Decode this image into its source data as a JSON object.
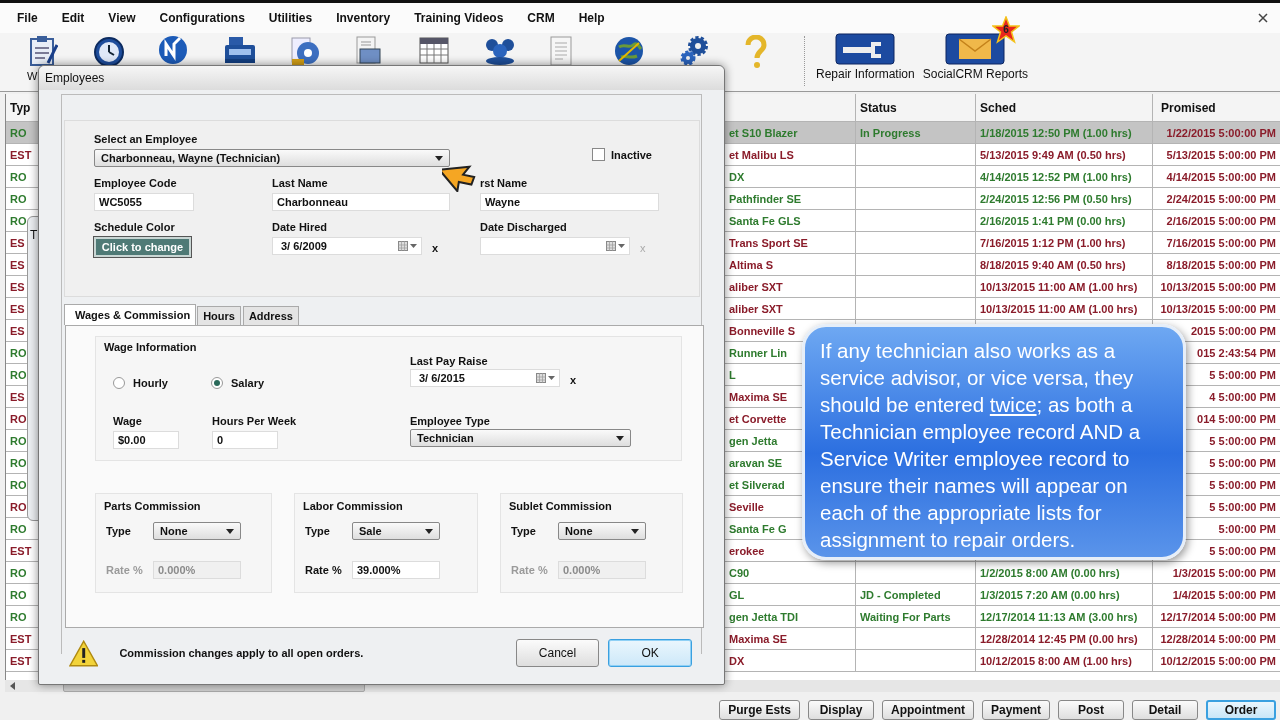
{
  "menu": [
    "File",
    "Edit",
    "View",
    "Configurations",
    "Utilities",
    "Inventory",
    "Training Videos",
    "CRM",
    "Help"
  ],
  "toolbar": {
    "buttons": [
      {
        "kind": "clipboard",
        "label": "W"
      },
      {
        "kind": "clock"
      },
      {
        "kind": "check-circle"
      },
      {
        "kind": "register"
      },
      {
        "kind": "disc"
      },
      {
        "kind": "files"
      },
      {
        "kind": "calendar"
      },
      {
        "kind": "people"
      },
      {
        "kind": "document"
      },
      {
        "kind": "globe"
      },
      {
        "kind": "gears"
      },
      {
        "kind": "help"
      }
    ],
    "large_buttons": [
      {
        "kind": "wrench",
        "label": "Repair Information"
      },
      {
        "kind": "envelope",
        "label": "SocialCRM Reports",
        "badge": "6"
      }
    ]
  },
  "table": {
    "columns": [
      "Typ",
      "Status",
      "Sched",
      "Promised"
    ],
    "rows": [
      {
        "type": "RO",
        "vehicle": "et S10 Blazer",
        "status": "In Progress",
        "sched": "1/18/2015 12:50 PM (1.00 hrs)",
        "promised": "1/22/2015 5:00:00 PM",
        "color": "#2e7b2e",
        "selected": true
      },
      {
        "type": "EST",
        "vehicle": "et Malibu LS",
        "sched": "5/13/2015 9:49 AM (0.50 hrs)",
        "promised": "5/13/2015 5:00:00 PM",
        "color": "#8a1c2a",
        "selected": false
      },
      {
        "type": "RO",
        "vehicle": "DX",
        "sched": "4/14/2015 12:52 PM (1.00 hrs)",
        "promised": "4/14/2015 5:00:00 PM",
        "color": "#2e7b2e",
        "selected": false
      },
      {
        "type": "RO",
        "vehicle": "Pathfinder SE",
        "sched": "2/24/2015 12:56 PM (0.50 hrs)",
        "promised": "2/24/2015 5:00:00 PM",
        "color": "#2e7b2e",
        "selected": false
      },
      {
        "type": "RO",
        "vehicle": "Santa Fe GLS",
        "sched": "2/16/2015 1:41 PM (0.00 hrs)",
        "promised": "2/16/2015 5:00:00 PM",
        "color": "#2e7b2e",
        "selected": false
      },
      {
        "type": "ES",
        "vehicle": "Trans Sport SE",
        "sched": "7/16/2015 1:12 PM (1.00 hrs)",
        "promised": "7/16/2015 5:00:00 PM",
        "color": "#8a1c2a",
        "selected": false
      },
      {
        "type": "ES",
        "vehicle": "Altima S",
        "sched": "8/18/2015 9:40 AM (0.50 hrs)",
        "promised": "8/18/2015 5:00:00 PM",
        "color": "#8a1c2a",
        "selected": false
      },
      {
        "type": "ES",
        "vehicle": "aliber SXT",
        "sched": "10/13/2015 11:00 AM (1.00 hrs)",
        "promised": "10/13/2015 5:00:00 PM",
        "color": "#8a1c2a",
        "selected": false
      },
      {
        "type": "ES",
        "vehicle": "aliber SXT",
        "sched": "10/13/2015 11:00 AM (1.00 hrs)",
        "promised": "10/13/2015 5:00:00 PM",
        "color": "#8a1c2a",
        "selected": false
      },
      {
        "type": "ES",
        "vehicle": "Bonneville S",
        "promised": "2015 5:00:00 PM",
        "color": "#8a1c2a",
        "selected": false
      },
      {
        "type": "RO",
        "vehicle": "Runner Lin",
        "promised": "015 2:43:54 PM",
        "color": "#2e7b2e",
        "selected": false
      },
      {
        "type": "RO",
        "vehicle": "L",
        "promised": "5 5:00:00 PM",
        "color": "#2e7b2e",
        "selected": false
      },
      {
        "type": "ES",
        "vehicle": "Maxima SE",
        "promised": "4 5:00:00 PM",
        "color": "#8a1c2a",
        "selected": false
      },
      {
        "type": "RO",
        "vehicle": "et Corvette",
        "promised": "014 5:00:00 PM",
        "color": "#8a1c2a",
        "selected": false
      },
      {
        "type": "RO",
        "vehicle": "gen Jetta",
        "promised": "5 5:00:00 PM",
        "color": "#2e7b2e",
        "selected": false
      },
      {
        "type": "RO",
        "vehicle": "aravan SE",
        "promised": "5 5:00:00 PM",
        "color": "#2e7b2e",
        "selected": false
      },
      {
        "type": "RO",
        "vehicle": "et Silverad",
        "promised": "5 5:00:00 PM",
        "color": "#2e7b2e",
        "selected": false
      },
      {
        "type": "RO",
        "vehicle": "Seville",
        "promised": "5 5:00:00 PM",
        "color": "#8a1c2a",
        "selected": false
      },
      {
        "type": "RO",
        "vehicle": "Santa Fe G",
        "promised": "5:00:00 PM",
        "color": "#2e7b2e",
        "selected": false
      },
      {
        "type": "EST",
        "vehicle": "erokee",
        "promised": "5 5:00:00 PM",
        "color": "#8a1c2a",
        "selected": false
      },
      {
        "type": "RO",
        "vehicle": "C90",
        "sched": "1/2/2015 8:00 AM (0.00 hrs)",
        "promised": "1/3/2015 5:00:00 PM",
        "color": "#2e7b2e",
        "selected": false
      },
      {
        "type": "RO",
        "vehicle": "GL",
        "status": "JD - Completed",
        "sched": "1/3/2015 7:20 AM (0.00 hrs)",
        "promised": "1/4/2015 5:00:00 PM",
        "color": "#2e7b2e",
        "selected": false
      },
      {
        "type": "RO",
        "vehicle": "gen Jetta TDI",
        "status": "Waiting For Parts",
        "sched": "12/17/2014 11:13 AM (3.00 hrs)",
        "promised": "12/17/2014 5:00:00 PM",
        "color": "#2e7b2e",
        "selected": false
      },
      {
        "type": "EST",
        "vehicle": "Maxima SE",
        "sched": "12/28/2014 12:45 PM (0.00 hrs)",
        "promised": "12/28/2014 5:00:00 PM",
        "color": "#8a1c2a",
        "selected": false
      },
      {
        "type": "EST",
        "vehicle": "DX",
        "sched": "10/12/2015 8:00 AM (1.00 hrs)",
        "promised": "10/12/2015 5:00:00 PM",
        "color": "#8a1c2a",
        "selected": false
      }
    ]
  },
  "bottom_buttons": [
    {
      "label": "Purge Ests",
      "focused": false
    },
    {
      "label": "Display",
      "focused": false
    },
    {
      "label": "Appointment",
      "focused": false
    },
    {
      "label": "Payment",
      "focused": false
    },
    {
      "label": "Post",
      "focused": false
    },
    {
      "label": "Detail",
      "focused": false
    },
    {
      "label": "Order",
      "focused": true
    }
  ],
  "background_window": {
    "title": "T"
  },
  "dialog": {
    "title": "Employees",
    "select_label": "Select an Employee",
    "employee_select": "Charbonneau, Wayne (Technician)",
    "inactive": {
      "label": "Inactive",
      "checked": false
    },
    "fields": [
      {
        "label": "Employee Code",
        "value": "WC5055"
      },
      {
        "label": "Last Name",
        "value": "Charbonneau"
      },
      {
        "label": "rst Name",
        "value": "Wayne"
      }
    ],
    "schedule_color": {
      "label": "Schedule Color",
      "button": "Click to change"
    },
    "dates": [
      {
        "label": "Date Hired",
        "value": "3/ 6/2009",
        "clear": "x",
        "disabled": false
      },
      {
        "label": "Date Discharged",
        "clear": "x",
        "disabled": true
      }
    ],
    "tabs": [
      {
        "label": "Wages & Commission",
        "selected": true
      },
      {
        "label": "Hours",
        "selected": false
      },
      {
        "label": "Address",
        "selected": false
      }
    ],
    "wage": {
      "title": "Wage Information",
      "pay_types": [
        {
          "label": "Hourly",
          "selected": false
        },
        {
          "label": "Salary",
          "selected": true
        }
      ],
      "last_pay_raise": {
        "label": "Last Pay Raise",
        "value": "3/ 6/2015",
        "clear": "x"
      },
      "wage": {
        "label": "Wage",
        "value": "$0.00"
      },
      "hours_per_week": {
        "label": "Hours Per Week",
        "value": "0"
      },
      "employee_type": {
        "label": "Employee Type",
        "value": "Technician"
      }
    },
    "commissions": [
      {
        "title": "Parts Commission",
        "type_label": "Type",
        "type": "None",
        "rate_label": "Rate %",
        "rate": "0.000%",
        "disabled": true
      },
      {
        "title": "Labor Commission",
        "type_label": "Type",
        "type": "Sale",
        "rate_label": "Rate %",
        "rate": "39.000%",
        "disabled": false
      },
      {
        "title": "Sublet Commission",
        "type_label": "Type",
        "type": "None",
        "rate_label": "Rate %",
        "rate": "0.000%",
        "disabled": true
      }
    ],
    "notice": "Commission changes apply to all open orders.",
    "buttons": [
      {
        "label": "Cancel",
        "focused": false
      },
      {
        "label": "OK",
        "focused": true
      }
    ]
  },
  "callout": {
    "before": "If any technician also works as a service advisor, or vice versa, they should be entered ",
    "underlined": "twice",
    "after": "; as both a Technician employee record AND a Service Writer employee record to ensure their names will appear on each of the appropriate lists for assignment to repair orders."
  }
}
